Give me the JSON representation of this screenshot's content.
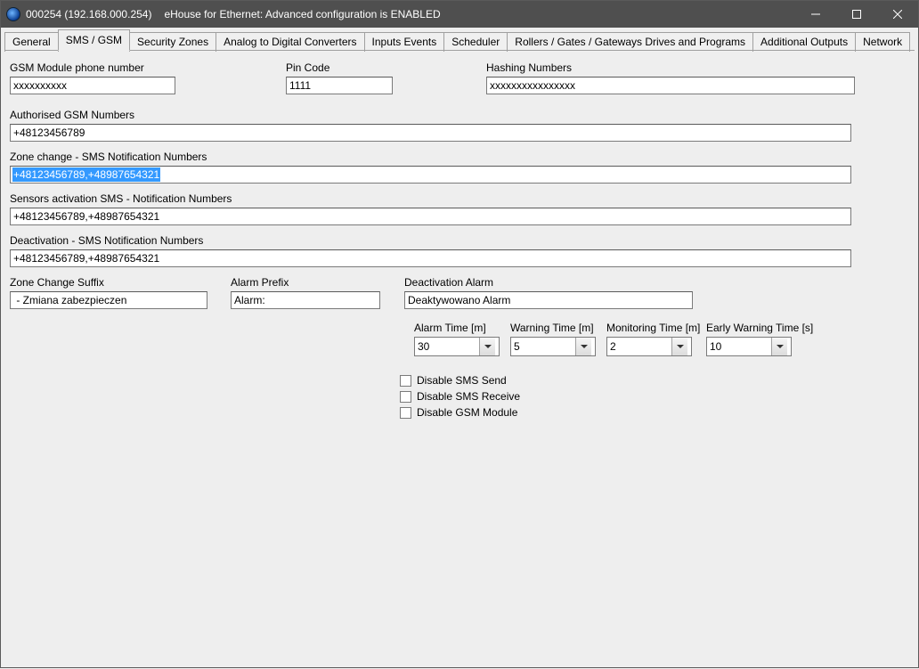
{
  "window": {
    "title_left": "000254 (192.168.000.254)",
    "title_right": "eHouse for Ethernet: Advanced configuration is ENABLED"
  },
  "tabs": [
    "General",
    "SMS / GSM",
    "Security Zones",
    "Analog to Digital Converters",
    "Inputs Events",
    "Scheduler",
    "Rollers / Gates / Gateways Drives  and Programs",
    "Additional Outputs",
    "Network"
  ],
  "active_tab_index": 1,
  "labels": {
    "gsm_phone": "GSM Module phone number",
    "pin_code": "Pin Code",
    "hashing": "Hashing Numbers",
    "authorised": "Authorised GSM Numbers",
    "zone_change_notify": "Zone change - SMS Notification Numbers",
    "sensors_activation": "Sensors activation SMS - Notification Numbers",
    "deactivation_notify": "Deactivation - SMS Notification Numbers",
    "zone_change_suffix": "Zone Change Suffix",
    "alarm_prefix": "Alarm Prefix",
    "deactivation_alarm": "Deactivation Alarm",
    "alarm_time": "Alarm Time [m]",
    "warning_time": "Warning Time [m]",
    "monitoring_time": "Monitoring Time [m]",
    "early_warning_time": "Early Warning Time [s]",
    "disable_sms_send": "Disable SMS Send",
    "disable_sms_receive": "Disable SMS Receive",
    "disable_gsm_module": "Disable GSM Module"
  },
  "values": {
    "gsm_phone": "xxxxxxxxxx",
    "pin_code": "1111",
    "hashing": "xxxxxxxxxxxxxxxx",
    "authorised": "+48123456789",
    "zone_change_notify": "+48123456789,+48987654321",
    "sensors_activation": "+48123456789,+48987654321",
    "deactivation_notify": "+48123456789,+48987654321",
    "zone_change_suffix": " - Zmiana zabezpieczen",
    "alarm_prefix": "Alarm:",
    "deactivation_alarm": "Deaktywowano Alarm",
    "alarm_time": "30",
    "warning_time": "5",
    "monitoring_time": "2",
    "early_warning_time": "10"
  },
  "checkboxes": {
    "disable_sms_send": false,
    "disable_sms_receive": false,
    "disable_gsm_module": false
  }
}
